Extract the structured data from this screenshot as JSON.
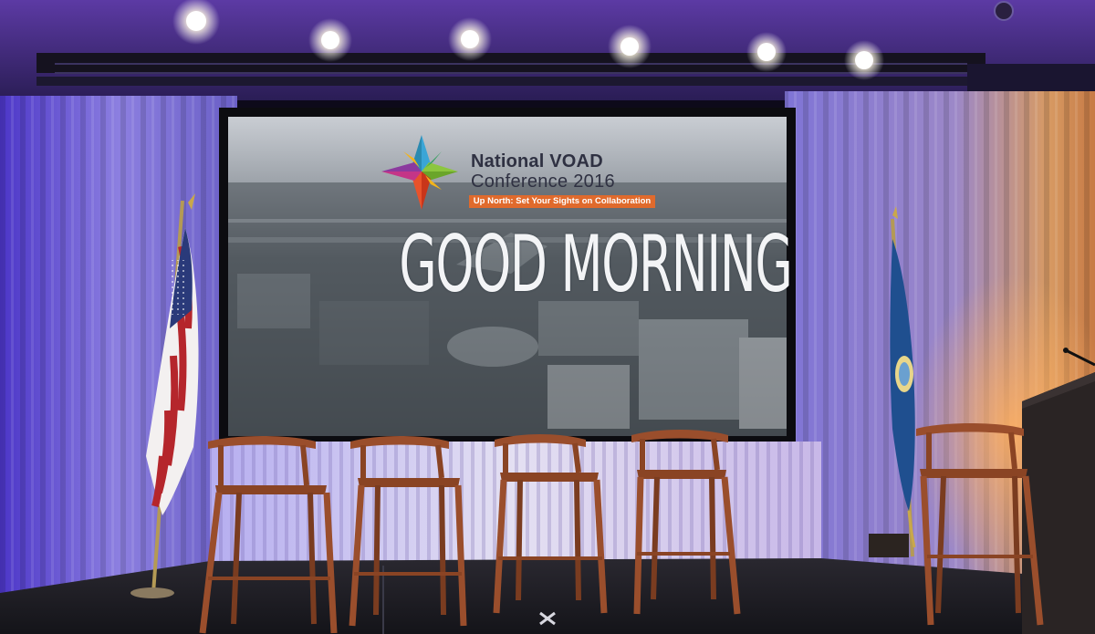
{
  "screen": {
    "conference_line1": "National VOAD",
    "conference_line2": "Conference 2016",
    "tagline": "Up North: Set Your Sights on Collaboration",
    "headline": "GOOD MORNING"
  },
  "colors": {
    "curtain": "#7a6fd0",
    "curtain_warm": "#e0a060",
    "stage_floor": "#1b1b22",
    "tagline_bar": "#e06a2c",
    "chair_wood": "#9a4e2c",
    "flag_red": "#b5262c",
    "flag_blue": "#2a3a7a",
    "state_flag_blue": "#1f4f8f"
  },
  "scene_elements": {
    "lights": 6,
    "stools": 5,
    "flags": [
      "united-states-flag",
      "minnesota-flag"
    ]
  }
}
